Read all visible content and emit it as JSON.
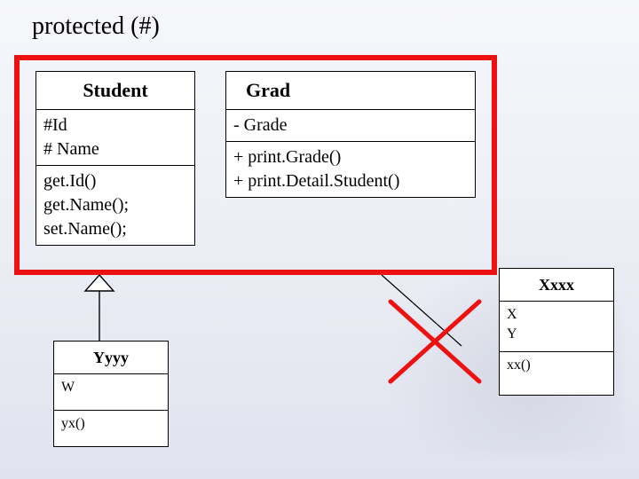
{
  "title": "protected (#)",
  "student": {
    "name": "Student",
    "attrs": "#Id\n# Name",
    "ops": "get.Id()\nget.Name();\nset.Name();"
  },
  "grad": {
    "name": "Grad",
    "attrs": "- Grade",
    "ops": "+ print.Grade()\n+ print.Detail.Student()"
  },
  "yyyy": {
    "name": "Yyyy",
    "attrs": "W",
    "ops": "yx()"
  },
  "xxxx": {
    "name": "Xxxx",
    "attrs": "X\nY",
    "ops": "xx()"
  }
}
